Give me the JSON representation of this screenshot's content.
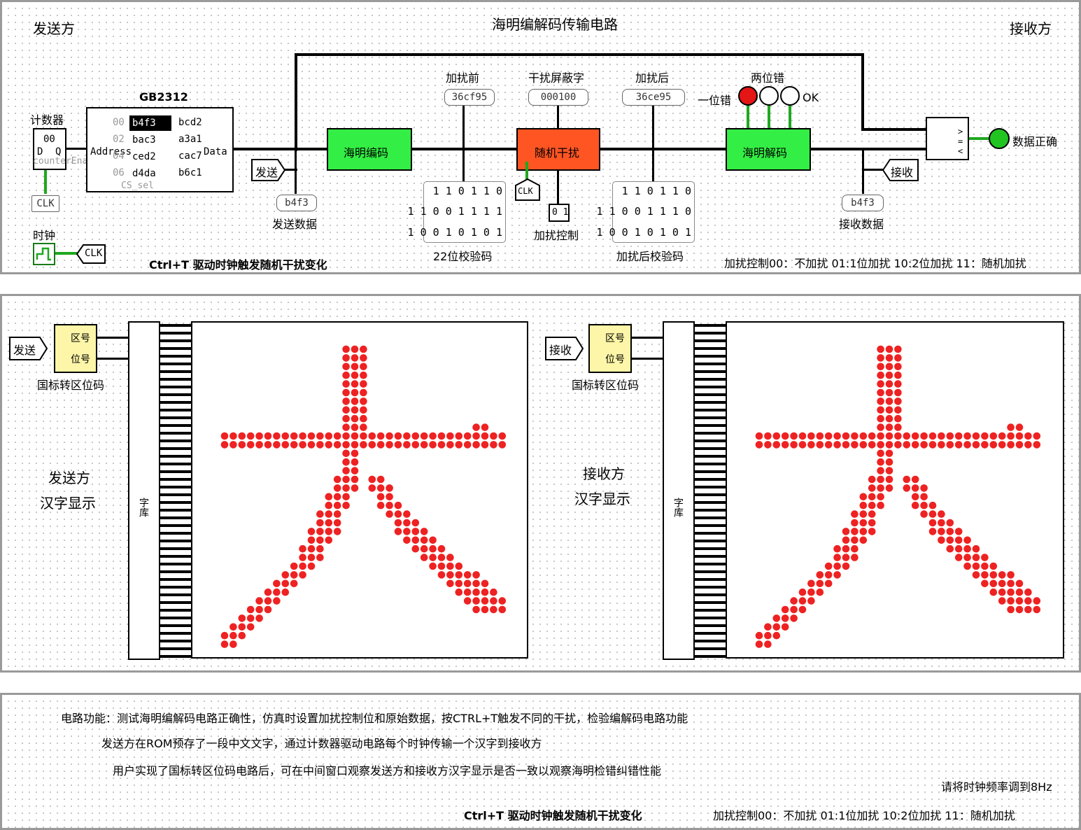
{
  "top": {
    "title": "海明编解码传输电路",
    "sender_label": "发送方",
    "receiver_label": "接收方",
    "counter": {
      "label": "计数器",
      "value": "00",
      "d": "D",
      "q": "Q",
      "enable": "counterEnable"
    },
    "rom": {
      "title": "GB2312",
      "address_label": "Address",
      "data_label": "Data",
      "cs_label": "CS_sel",
      "rows": [
        {
          "addr": "00",
          "c1": "b4f3",
          "c2": "bcd2"
        },
        {
          "addr": "02",
          "c1": "bac3",
          "c2": "a3a1"
        },
        {
          "addr": "04",
          "c1": "ced2",
          "c2": "cac7"
        },
        {
          "addr": "06",
          "c1": "d4da",
          "c2": "b6c1"
        }
      ],
      "selected": "b4f3"
    },
    "clk_label": "CLK",
    "clock_label": "时钟",
    "send_tunnel": "发送",
    "recv_tunnel": "接收",
    "send_data_value": "b4f3",
    "send_data_label": "发送数据",
    "recv_data_value": "b4f3",
    "recv_data_label": "接收数据",
    "encoder_label": "海明编码",
    "noise_label": "随机干扰",
    "decoder_label": "海明解码",
    "before_label": "加扰前",
    "before_value": "36cf95",
    "mask_label": "干扰屏蔽字",
    "mask_value": "000100",
    "after_label": "加扰后",
    "after_value": "36ce95",
    "check_before": [
      "1 1 0 1 1 0",
      "1 1 0 0 1 1 1 1",
      "1 0 0 1 0 1 0 1"
    ],
    "check_before_label": "22位校验码",
    "check_after": [
      "1 1 0 1 1 0",
      "1 1 0 0 1 1 1 0",
      "1 0 0 1 0 1 0 1"
    ],
    "check_after_label": "加扰后校验码",
    "control_value": "0 1",
    "control_label": "加扰控制",
    "two_bit_label": "两位错",
    "one_bit_label": "一位错",
    "ok_label": "OK",
    "correct_label": "数据正确",
    "footer_left": "Ctrl+T 驱动时钟触发随机干扰变化",
    "footer_right": "加扰控制00：不加扰  01:1位加扰 10:2位加扰 11：随机加扰",
    "led_one_bit_color": "#e31515",
    "led_correct_color": "#22c422",
    "encoder_color": "#33ee44",
    "noise_color": "#ff5522"
  },
  "middle": {
    "send_tunnel": "发送",
    "recv_tunnel": "接收",
    "converter_zone": "区号",
    "converter_pos": "位号",
    "converter_label": "国标转区位码",
    "font_lib_label": "字库",
    "sender_display_line1": "发送方",
    "sender_display_line2": "汉字显示",
    "receiver_display_line1": "接收方",
    "receiver_display_line2": "汉字显示",
    "glyph_char": "大",
    "dot_color": "#ee2222"
  },
  "bottom": {
    "line1": "电路功能：测试海明编解码电路正确性，仿真时设置加扰控制位和原始数据，按CTRL+T触发不同的干扰，检验编解码电路功能",
    "line2": "发送方在ROM预存了一段中文文字，通过计数器驱动电路每个时钟传输一个汉字到接收方",
    "line3": "用户实现了国标转区位码电路后，可在中间窗口观察发送方和接收方汉字显示是否一致以观察海明检错纠错性能",
    "clock_note": "请将时钟频率调到8Hz",
    "footer_left": "Ctrl+T 驱动时钟触发随机干扰变化",
    "footer_right": "加扰控制00：不加扰  01:1位加扰 10:2位加扰 11：随机加扰"
  }
}
